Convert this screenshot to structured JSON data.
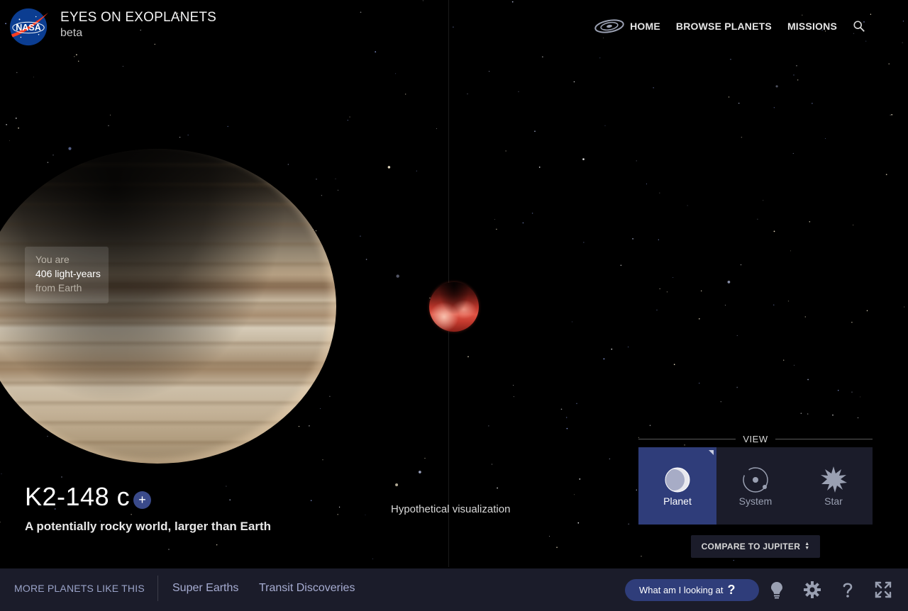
{
  "header": {
    "logo_alt": "NASA",
    "title": "EYES ON EXOPLANETS",
    "subtitle": "beta",
    "nav": [
      {
        "label": "HOME",
        "icon": "galaxy-icon"
      },
      {
        "label": "BROWSE PLANETS"
      },
      {
        "label": "MISSIONS"
      }
    ],
    "search_icon": "search-icon"
  },
  "scene": {
    "distance": {
      "line1": "You are",
      "line2": "406 light-years",
      "line3": "from Earth"
    },
    "caption": "Hypothetical visualization",
    "colors": {
      "planet_red": "#c43a2e",
      "jupiter_tan": "#c3b196"
    }
  },
  "planet": {
    "name": "K2-148 c",
    "add_label": "+",
    "description": "A potentially rocky world, larger than Earth"
  },
  "view": {
    "label": "VIEW",
    "options": [
      {
        "label": "Planet",
        "icon": "planet-icon",
        "active": true
      },
      {
        "label": "System",
        "icon": "system-icon",
        "active": false
      },
      {
        "label": "Star",
        "icon": "star-icon",
        "active": false
      }
    ],
    "compare_label": "COMPARE TO JUPITER"
  },
  "bottom_bar": {
    "more_label": "MORE PLANETS LIKE THIS",
    "links": [
      "Super Earths",
      "Transit Discoveries"
    ],
    "what_label": "What am I looking at",
    "what_icon": "?",
    "tools": [
      "lightbulb-icon",
      "gear-icon",
      "help-icon",
      "fullscreen-icon"
    ]
  },
  "colors": {
    "accent": "#2f3d7a",
    "panel": "#1b1c2a",
    "link": "#a6acd1"
  }
}
